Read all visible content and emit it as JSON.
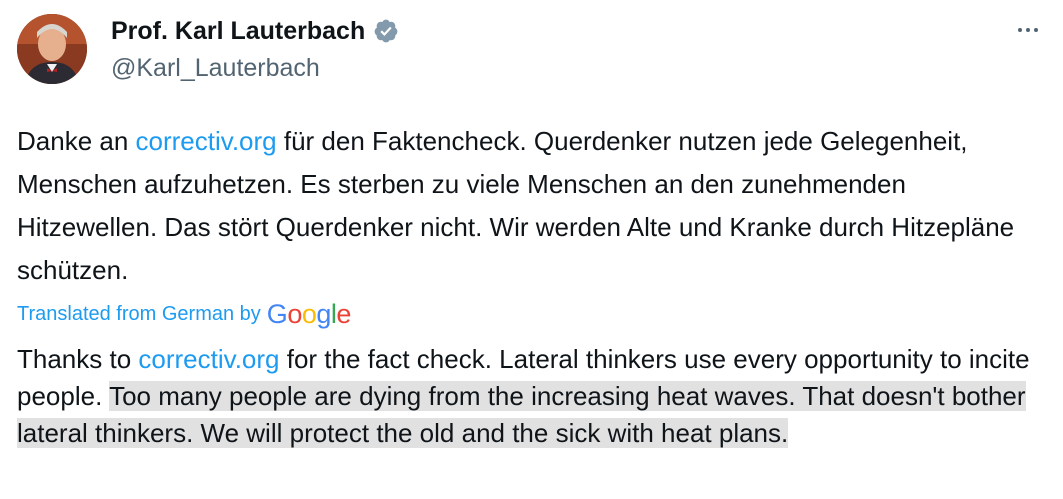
{
  "author": {
    "name": "Prof. Karl Lauterbach",
    "handle": "@Karl_Lauterbach",
    "verified": true
  },
  "tweet": {
    "part1": "Danke an ",
    "link": "correctiv.org",
    "part2": " für den Faktencheck. Querdenker nutzen jede Gelegenheit, Menschen aufzuhetzen. Es sterben zu viele Menschen an den zunehmenden Hitzewellen. Das stört Querdenker nicht. Wir werden Alte und Kranke durch Hitzepläne schützen."
  },
  "translation": {
    "label": "Translated from German by",
    "provider": "Google",
    "part1": "Thanks to ",
    "link": "correctiv.org",
    "part2": " for the fact check. Lateral thinkers use every opportunity to incite people. ",
    "highlighted": "Too many people are dying from the increasing heat waves. That doesn't bother lateral thinkers. We will protect the old and the sick with heat plans."
  },
  "colors": {
    "link": "#1d9bf0",
    "verified_badge": "#829aab",
    "highlight": "#e1e1e1"
  },
  "icons": {
    "badge": "verified-badge-icon",
    "more": "more-options-icon"
  }
}
